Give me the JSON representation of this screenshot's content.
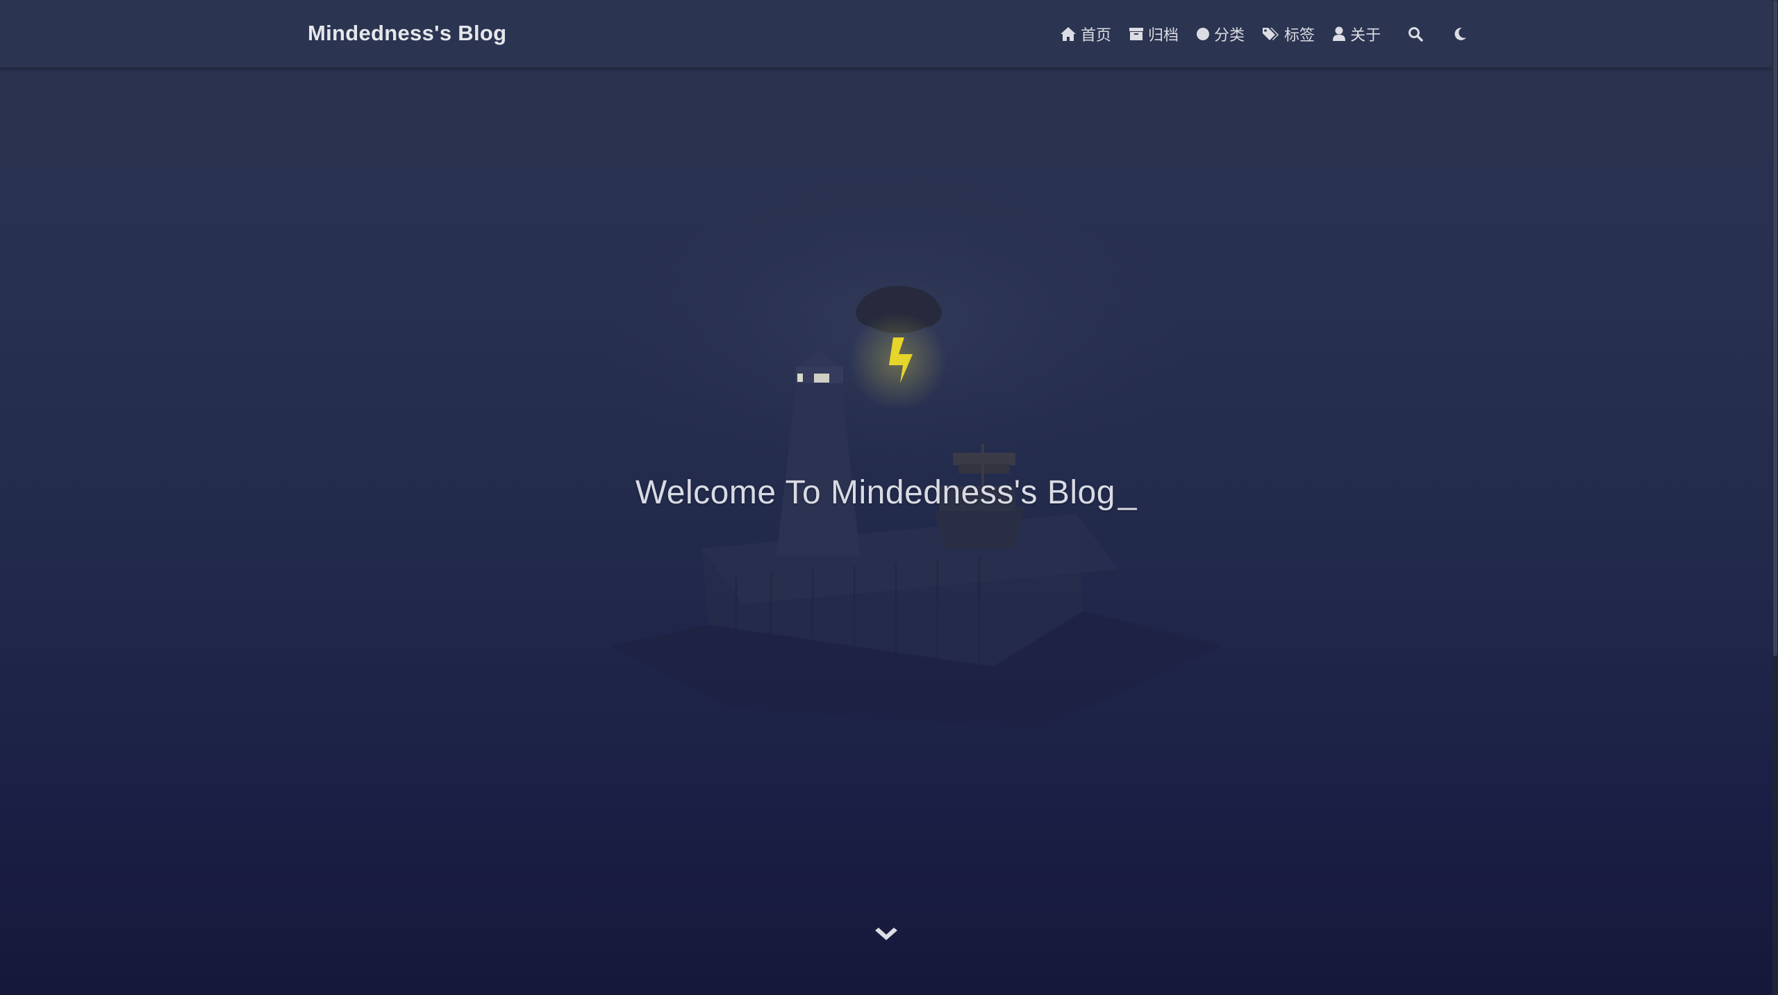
{
  "header": {
    "brand": "Mindedness's Blog"
  },
  "nav": {
    "items": [
      {
        "label": "首页",
        "icon": "home-icon"
      },
      {
        "label": "归档",
        "icon": "archive-icon"
      },
      {
        "label": "分类",
        "icon": "circle-icon"
      },
      {
        "label": "标签",
        "icon": "tags-icon"
      },
      {
        "label": "关于",
        "icon": "user-icon"
      }
    ],
    "search_icon": "search-icon",
    "theme_icon": "moon-icon"
  },
  "hero": {
    "title": "Welcome To Mindedness's Blog",
    "cursor": "_",
    "scroll_icon": "chevron-down-icon"
  },
  "colors": {
    "navbar_bg": "#2b3450",
    "text": "#dcdde4",
    "lightning": "#e6d52a"
  }
}
